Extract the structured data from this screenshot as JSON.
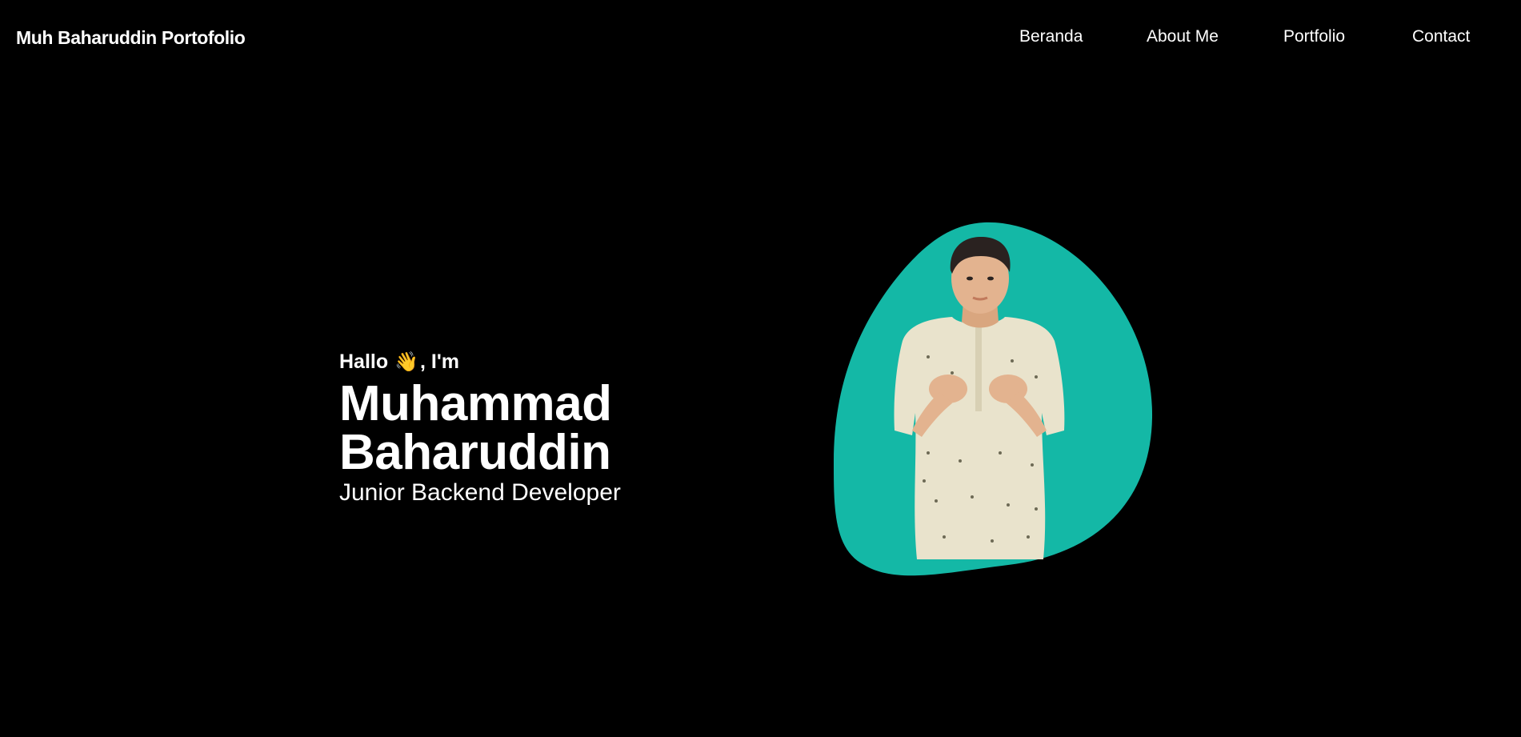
{
  "navbar": {
    "brand": "Muh Baharuddin Portofolio",
    "links": [
      "Beranda",
      "About Me",
      "Portfolio",
      "Contact"
    ]
  },
  "hero": {
    "greeting_prefix": "Hallo",
    "greeting_emoji": "👋",
    "greeting_suffix": ", I'm",
    "name_line1": "Muhammad",
    "name_line2": "Baharuddin",
    "role": "Junior Backend Developer"
  },
  "colors": {
    "background": "#000000",
    "text": "#ffffff",
    "blob": "#14b8a6",
    "shirt": "#e9e3cc",
    "skin": "#e3b38f",
    "hair": "#2a2220"
  },
  "icons": {
    "wave": "waving-hand-icon"
  }
}
